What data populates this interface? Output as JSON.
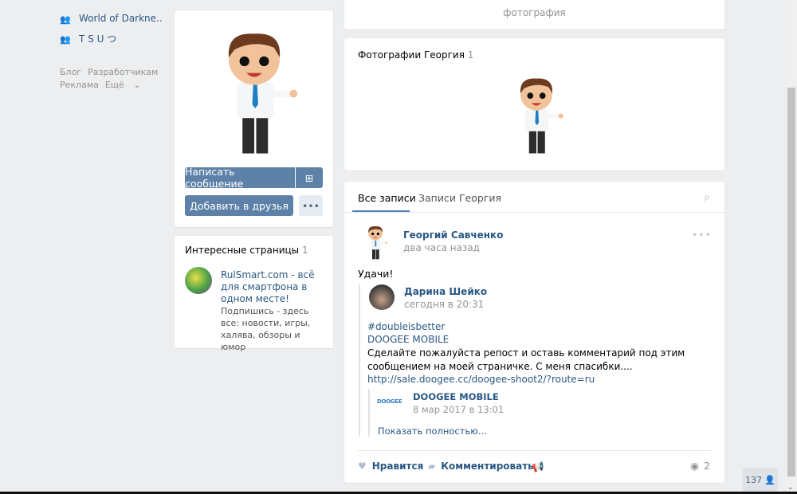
{
  "left_nav": {
    "groups": [
      {
        "label": "World of Darkne.."
      },
      {
        "label": "T S U つ"
      }
    ],
    "footer": {
      "blog": "Блог",
      "developers": "Разработчикам",
      "ads": "Реклама",
      "more": "Ещё"
    }
  },
  "profile": {
    "send_message": "Написать сообщение",
    "add_friend": "Добавить в друзья"
  },
  "interesting": {
    "title": "Интересные страницы",
    "count": "1",
    "item_title": "RulSmart.com - всё для смартфона в одном месте!",
    "item_desc": "Подпишись - здесь все: новости, игры, халява, обзоры и юмор"
  },
  "top_card": {
    "label": "фотография"
  },
  "photos": {
    "title": "Фотографии Георгия",
    "count": "1"
  },
  "wall": {
    "tabs": [
      "Все записи",
      "Записи Георгия"
    ],
    "post": {
      "author": "Георгий Савченко",
      "time": "два часа назад",
      "text": "Удачи!",
      "repost": {
        "author": "Дарина Шейко",
        "time": "сегодня в 20:31",
        "hashtag": "#doubleisbetter",
        "source": "DOOGEE MOBILE",
        "text": "Сделайте пожалуйста репост и оставь комментарий под этим сообщением на моей страничке. С меня спасибки....",
        "link": "http://sale.doogee.cc/doogee-shoot2/?route=ru",
        "inner": {
          "author": "DOOGEE MOBILE",
          "logo": "DOOGEE",
          "time": "8 мар 2017 в 13:01",
          "show_more": "Показать полностью..."
        }
      },
      "like": "Нравится",
      "comment": "Комментировать",
      "views": "2"
    }
  },
  "online_counter": "137",
  "colors": {
    "accent": "#5e81a8",
    "link": "#2a5885",
    "bg": "#edeef0"
  }
}
